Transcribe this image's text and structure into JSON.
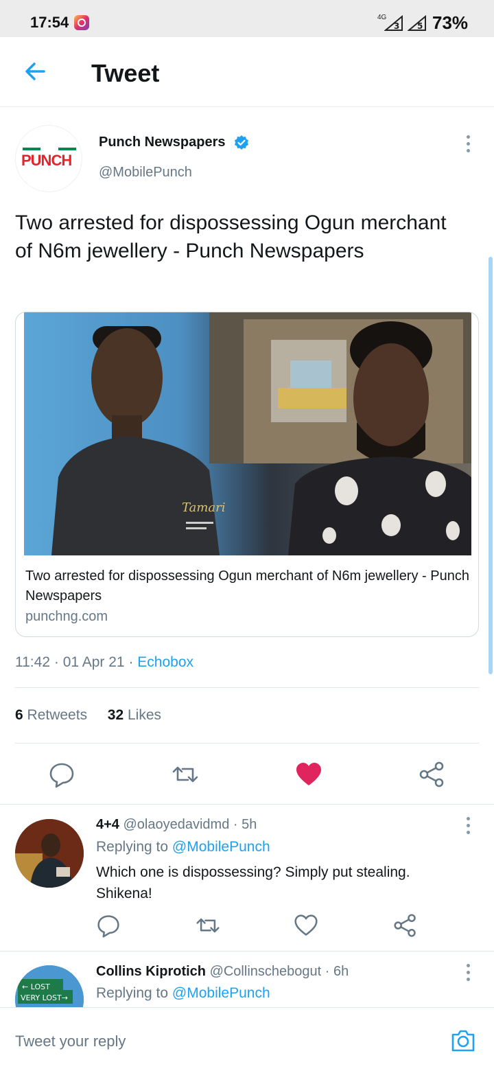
{
  "status_bar": {
    "time": "17:54",
    "network": "4G",
    "sim1": "3",
    "sim2": "5",
    "battery": "73%"
  },
  "header": {
    "title": "Tweet"
  },
  "tweet": {
    "author_name": "Punch Newspapers",
    "author_handle": "@MobilePunch",
    "avatar_logo_text": "PUNCH",
    "text": "Two arrested for dispossessing Ogun merchant of N6m jewellery - Punch Newspapers",
    "card": {
      "title": "Two arrested for dispossessing Ogun merchant of N6m jewellery - Punch Newspapers",
      "domain": "punchng.com",
      "shirt_logo": "Tamari"
    },
    "time": "11:42",
    "date": "01 Apr 21",
    "source": "Echobox",
    "sep": "·",
    "retweets_count": "6",
    "retweets_label": "Retweets",
    "likes_count": "32",
    "likes_label": "Likes",
    "liked": true
  },
  "replies": [
    {
      "name": "4+4",
      "handle": "@olaoyedavidmd",
      "age": "· 5h",
      "replying_prefix": "Replying to",
      "replying_to": "@MobilePunch",
      "text": "Which one is dispossessing? Simply put stealing. Shikena!"
    },
    {
      "name": "Collins Kiprotich",
      "handle": "@Collinschebogut",
      "age": "· 6h",
      "replying_prefix": "Replying to",
      "replying_to": "@MobilePunch",
      "sign_top": "← LOST",
      "sign_bottom": "VERY LOST→"
    }
  ],
  "composer": {
    "placeholder": "Tweet your reply"
  },
  "colors": {
    "accent": "#1da1f2",
    "like": "#e0245e",
    "muted": "#657786"
  }
}
